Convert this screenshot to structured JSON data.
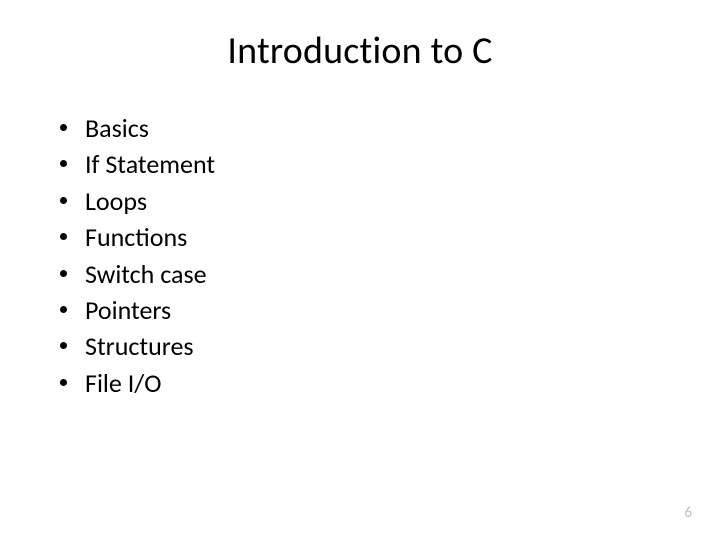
{
  "slide": {
    "title": "Introduction to C",
    "bullets": [
      "Basics",
      "If Statement",
      "Loops",
      "Functions",
      "Switch case",
      "Pointers",
      "Structures",
      "File I/O"
    ],
    "page_number": "6"
  }
}
